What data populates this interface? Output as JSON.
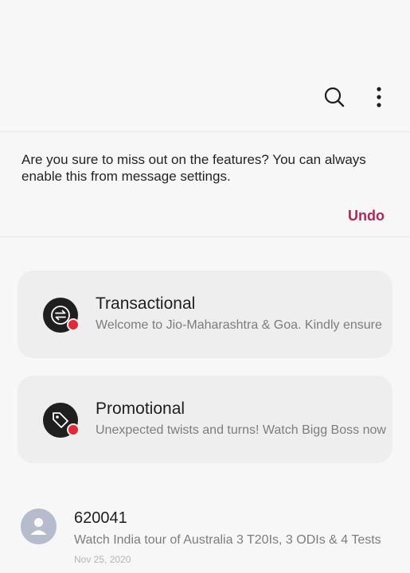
{
  "toolbar": {
    "search_icon": "search-icon",
    "more_icon": "more-options-icon"
  },
  "notice": {
    "message": "Are you sure to miss out on the features? You can always enable this from message settings.",
    "undo_label": "Undo",
    "undo_color": "#b52752"
  },
  "categories": [
    {
      "title": "Transactional",
      "preview": "Welcome to Jio-Maharashtra & Goa. Kindly ensure",
      "icon": "transfer-arrows-icon",
      "unread": true
    },
    {
      "title": "Promotional",
      "preview": "Unexpected twists and turns! Watch Bigg Boss now",
      "icon": "price-tag-icon",
      "unread": true
    }
  ],
  "conversations": [
    {
      "sender": "620041",
      "preview": "Watch India tour of Australia 3 T20Is, 3 ODIs & 4 Tests",
      "date": "Nov 25, 2020",
      "avatar_icon": "person-icon"
    }
  ],
  "colors": {
    "background": "#f7f7f7",
    "card_background": "#eeeeee",
    "unread_badge": "#e3283a",
    "avatar_background": "#b7bccd"
  }
}
